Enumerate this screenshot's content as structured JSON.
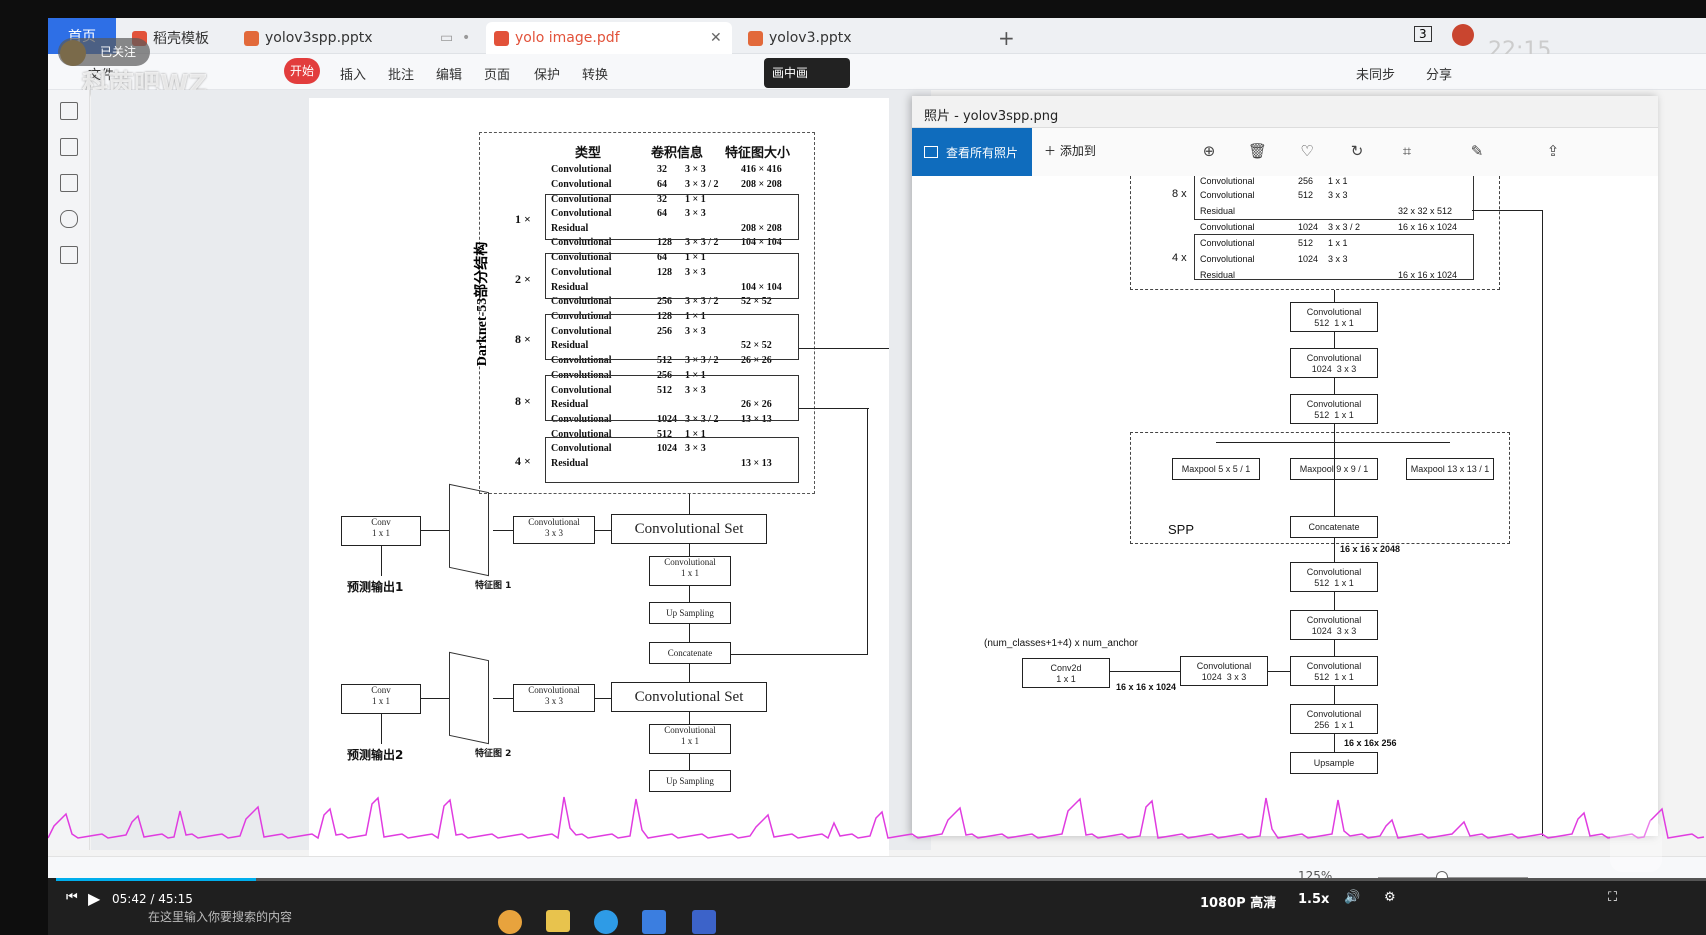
{
  "tabs": [
    {
      "label": "首页"
    },
    {
      "label": "稻壳模板"
    },
    {
      "label": "yolov3spp.pptx"
    },
    {
      "label": "yolo image.pdf"
    },
    {
      "label": "yolov3.pptx"
    }
  ],
  "tab_new": "+",
  "toolbar": {
    "file": "文件",
    "start": "开始",
    "insert": "插入",
    "annotate": "批注",
    "edit": "编辑",
    "page": "页面",
    "protect": "保护",
    "convert": "转换",
    "sync": "未同步",
    "share": "分享"
  },
  "follow": {
    "badge": "已关注"
  },
  "pip": {
    "label": "画中画"
  },
  "clock": "22:15",
  "counter": "3",
  "watermark": "科芮吧WZ",
  "photos": {
    "title": "照片 - yolov3spp.png",
    "view_all": "查看所有照片",
    "add_to": "添加到"
  },
  "doc": {
    "header": {
      "type": "类型",
      "conv": "卷积信息",
      "size": "特征图大小"
    },
    "side": "Darknet-53部分结构",
    "rows": [
      {
        "t": "Convolutional",
        "c": "32",
        "k": "3 × 3",
        "s": "416 × 416"
      },
      {
        "t": "Convolutional",
        "c": "64",
        "k": "3 × 3 / 2",
        "s": "208 × 208"
      },
      {
        "t": "Convolutional",
        "c": "32",
        "k": "1 × 1",
        "s": ""
      },
      {
        "t": "Convolutional",
        "c": "64",
        "k": "3 × 3",
        "s": ""
      },
      {
        "t": "Residual",
        "c": "",
        "k": "",
        "s": "208 × 208"
      },
      {
        "t": "Convolutional",
        "c": "128",
        "k": "3 × 3 / 2",
        "s": "104 × 104"
      },
      {
        "t": "Convolutional",
        "c": "64",
        "k": "1 × 1",
        "s": ""
      },
      {
        "t": "Convolutional",
        "c": "128",
        "k": "3 × 3",
        "s": ""
      },
      {
        "t": "Residual",
        "c": "",
        "k": "",
        "s": "104 × 104"
      },
      {
        "t": "Convolutional",
        "c": "256",
        "k": "3 × 3 / 2",
        "s": "52 × 52"
      },
      {
        "t": "Convolutional",
        "c": "128",
        "k": "1 × 1",
        "s": ""
      },
      {
        "t": "Convolutional",
        "c": "256",
        "k": "3 × 3",
        "s": ""
      },
      {
        "t": "Residual",
        "c": "",
        "k": "",
        "s": "52 × 52"
      },
      {
        "t": "Convolutional",
        "c": "512",
        "k": "3 × 3 / 2",
        "s": "26 × 26"
      },
      {
        "t": "Convolutional",
        "c": "256",
        "k": "1 × 1",
        "s": ""
      },
      {
        "t": "Convolutional",
        "c": "512",
        "k": "3 × 3",
        "s": ""
      },
      {
        "t": "Residual",
        "c": "",
        "k": "",
        "s": "26 × 26"
      },
      {
        "t": "Convolutional",
        "c": "1024",
        "k": "3 × 3 / 2",
        "s": "13 × 13"
      },
      {
        "t": "Convolutional",
        "c": "512",
        "k": "1 × 1",
        "s": ""
      },
      {
        "t": "Convolutional",
        "c": "1024",
        "k": "3 × 3",
        "s": ""
      },
      {
        "t": "Residual",
        "c": "",
        "k": "",
        "s": "13 × 13"
      }
    ],
    "mult": [
      "1 ×",
      "2 ×",
      "8 ×",
      "8 ×",
      "4 ×"
    ],
    "convset": "Convolutional  Set",
    "conv1": "Convolutional\n1 x 1",
    "upsample": "Up Sampling",
    "concat": "Concatenate",
    "conv33": "Convolutional\n3 x 3",
    "convout": "Conv\n1 x 1",
    "pred1": "预测输出1",
    "pred2": "预测输出2",
    "feat1": "特征图 1",
    "feat2": "特征图 2"
  },
  "spp": {
    "top": [
      {
        "a": "Convolutional",
        "b": "256",
        "c": "1 x 1"
      },
      {
        "a": "Convolutional",
        "b": "512",
        "c": "3 x 3"
      },
      {
        "a": "Residual",
        "b": "",
        "c": "32 x 32 x 512"
      },
      {
        "a": "Convolutional",
        "b": "1024",
        "c": "3 x 3 / 2",
        "d": "16 x 16 x 1024"
      },
      {
        "a": "Convolutional",
        "b": "512",
        "c": "1 x 1"
      },
      {
        "a": "Convolutional",
        "b": "1024",
        "c": "3 x 3"
      },
      {
        "a": "Residual",
        "b": "",
        "c": "16 x 16 x 1024"
      }
    ],
    "m8": "8 x",
    "m4": "4 x",
    "c1": "Convolutional\n512  1 x 1",
    "c2": "Convolutional\n1024  3 x 3",
    "c3": "Convolutional\n512  1 x 1",
    "mp1": "Maxpool  5 x 5 / 1",
    "mp2": "Maxpool  9 x 9 / 1",
    "mp3": "Maxpool  13 x 13 / 1",
    "spp": "SPP",
    "cat": "Concatenate",
    "d2048": "16 x 16 x 2048",
    "c4": "Convolutional\n512  1 x 1",
    "c5": "Convolutional\n1024  3 x 3",
    "c6": "Convolutional\n512  1 x 1",
    "c7": "Convolutional\n1024  3 x 3",
    "c8": "Conv2d\n1 x 1",
    "d1024": "16 x 16 x 1024",
    "anchor": "(num_classes+1+4) x num_anchor",
    "c9": "Convolutional\n256  1 x 1",
    "d256": "16 x 16x 256",
    "up": "Upsample"
  },
  "status": {
    "zoom": "125%"
  },
  "video": {
    "time": "05:42 / 45:15",
    "quality": "1080P 高清",
    "speed": "1.5x",
    "search": "在这里输入你要搜索的内容"
  }
}
